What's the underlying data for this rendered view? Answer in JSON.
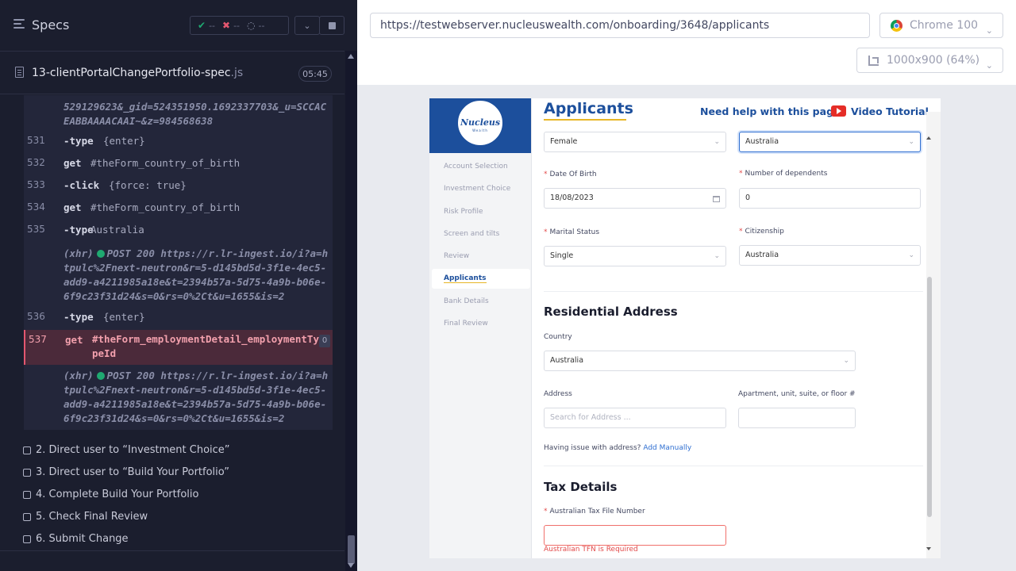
{
  "runner": {
    "title": "Specs",
    "stats": {
      "passed": "--",
      "failed": "--",
      "pending": "--"
    },
    "spec_file": {
      "name": "13-clientPortalChangePortfolio-spec",
      "ext": ".js",
      "duration": "05:45"
    },
    "log_top_fragment": "529129623&_gid=524351950.1692337703&_u=SCCACEABBAAAACAAI~&z=984568638",
    "commands": [
      {
        "num": "531",
        "name": "-type",
        "arg": "{enter}"
      },
      {
        "num": "532",
        "name": "get",
        "arg": "#theForm_country_of_birth"
      },
      {
        "num": "533",
        "name": "-click",
        "arg": "{force: true}"
      },
      {
        "num": "534",
        "name": "get",
        "arg": "#theForm_country_of_birth"
      },
      {
        "num": "535",
        "name": "-type",
        "arg": "Australia"
      },
      {
        "num": "536",
        "name": "-type",
        "arg": "{enter}"
      }
    ],
    "xhr_1": {
      "prefix": "(xhr)",
      "text": "POST 200 https://r.lr-ingest.io/i?a=htpulc%2Fnext-neutron&r=5-d145bd5d-3f1e-4ec5-add9-a4211985a18e&t=2394b57a-5d75-4a9b-b06e-6f9c23f31d24&s=0&rs=0%2Ct&u=1655&is=2"
    },
    "failed_cmd": {
      "num": "537",
      "name": "get",
      "selector": "#theForm_employmentDetail_employmentTypeId",
      "count": "0"
    },
    "xhr_2": {
      "prefix": "(xhr)",
      "text": "POST 200 https://r.lr-ingest.io/i?a=htpulc%2Fnext-neutron&r=5-d145bd5d-3f1e-4ec5-add9-a4211985a18e&t=2394b57a-5d75-4a9b-b06e-6f9c23f31d24&s=0&rs=0%2Ct&u=1655&is=2"
    },
    "tests": [
      "2. Direct user to “Investment Choice”",
      "3. Direct user to “Build Your Portfolio”",
      "4. Complete Build Your Portfolio",
      "5. Check Final Review",
      "6. Submit Change"
    ]
  },
  "browser": {
    "url": "https://testwebserver.nucleuswealth.com/onboarding/3648/applicants",
    "browser_name": "Chrome 100",
    "viewport": "1000x900",
    "scale": "(64%)"
  },
  "app": {
    "logo": {
      "main": "Nucleus",
      "sub": "Wealth"
    },
    "nav": [
      "Account Selection",
      "Investment Choice",
      "Risk Profile",
      "Screen and tilts",
      "Review",
      "Applicants",
      "Bank Details",
      "Final Review"
    ],
    "page_title": "Applicants",
    "help_text": "Need help with this page?",
    "video_text": "Video Tutorial",
    "gender_value": "Female",
    "country_of_birth_value": "Australia",
    "dob_label": "Date Of Birth",
    "dob_value": "18/08/2023",
    "dependents_label": "Number of dependents",
    "dependents_value": "0",
    "marital_label": "Marital Status",
    "marital_value": "Single",
    "citizenship_label": "Citizenship",
    "citizenship_value": "Australia",
    "residential_title": "Residential Address",
    "country_label": "Country",
    "country_value": "Australia",
    "address_label": "Address",
    "address_placeholder": "Search for Address ...",
    "apartment_label": "Apartment, unit, suite, or floor #",
    "address_issue": "Having issue with address?",
    "add_manually": "Add Manually",
    "tax_title": "Tax Details",
    "tfn_label": "Australian Tax File Number",
    "tfn_error": "Australian TFN is Required"
  }
}
